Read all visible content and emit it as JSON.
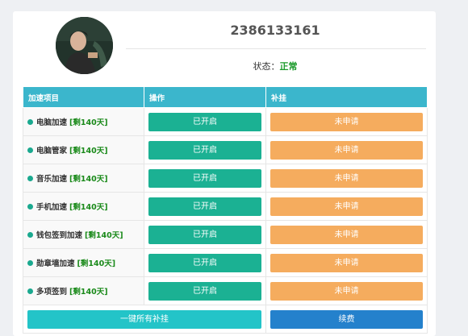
{
  "profile": {
    "account": "2386133161",
    "status_label": "状态：",
    "status_value": "正常"
  },
  "table": {
    "headers": [
      "加速项目",
      "操作",
      "补挂"
    ],
    "rows": [
      {
        "name": "电脑加速",
        "days": "[剩140天]",
        "action": "已开启",
        "supplement": "未申请"
      },
      {
        "name": "电脑管家",
        "days": "[剩140天]",
        "action": "已开启",
        "supplement": "未申请"
      },
      {
        "name": "音乐加速",
        "days": "[剩140天]",
        "action": "已开启",
        "supplement": "未申请"
      },
      {
        "name": "手机加速",
        "days": "[剩140天]",
        "action": "已开启",
        "supplement": "未申请"
      },
      {
        "name": "钱包签到加速",
        "days": "[剩140天]",
        "action": "已开启",
        "supplement": "未申请"
      },
      {
        "name": "勋章墙加速",
        "days": "[剩140天]",
        "action": "已开启",
        "supplement": "未申请"
      },
      {
        "name": "多项签到",
        "days": "[剩140天]",
        "action": "已开启",
        "supplement": "未申请"
      }
    ]
  },
  "footer": {
    "apply_all_label": "一键所有补挂",
    "renew_label": "续费"
  },
  "colors": {
    "header_bg": "#3bb6cc",
    "enabled_green": "#1bb193",
    "not_applied_orange": "#f5ac5e",
    "apply_all_teal": "#23c4c8",
    "renew_blue": "#2481cc",
    "status_green": "#1a9a2a"
  }
}
